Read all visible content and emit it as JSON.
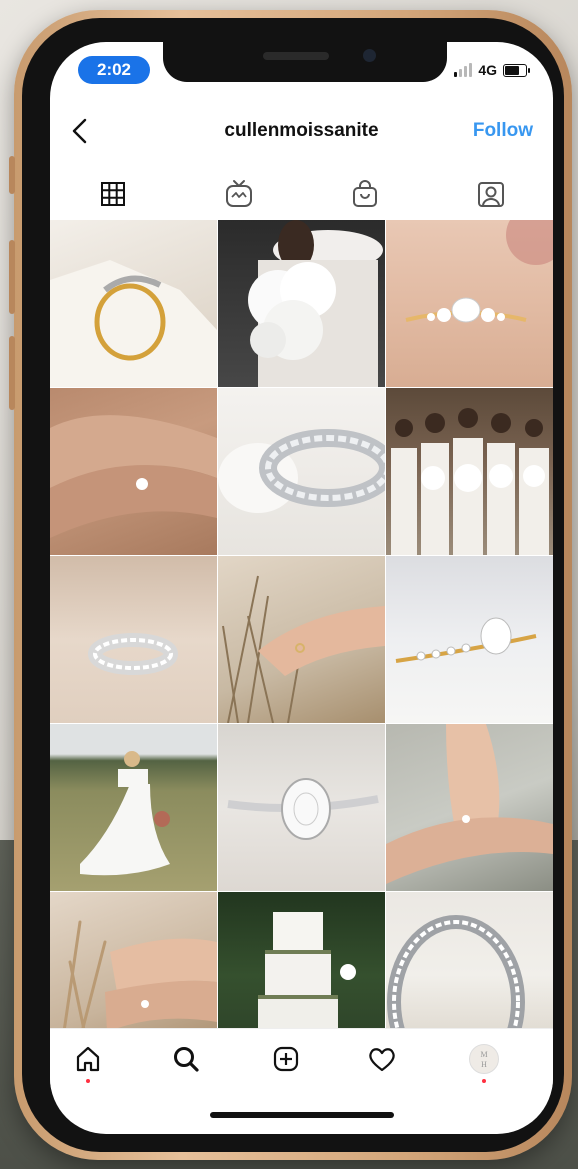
{
  "status_bar": {
    "time": "2:02",
    "network": "4G"
  },
  "header": {
    "username": "cullenmoissanite",
    "follow_label": "Follow",
    "back_icon": "chevron-left-icon"
  },
  "tabs": [
    {
      "icon": "grid-icon",
      "active": true
    },
    {
      "icon": "igtv-icon",
      "active": false
    },
    {
      "icon": "shopping-bag-icon",
      "active": false
    },
    {
      "icon": "tagged-user-icon",
      "active": false
    }
  ],
  "posts": [
    {
      "subject": "gold solitaire ring on white stone"
    },
    {
      "subject": "bride holding white bouquet"
    },
    {
      "subject": "oval cluster ring on peach background"
    },
    {
      "subject": "hands with oval engagement ring"
    },
    {
      "subject": "emerald cut eternity band"
    },
    {
      "subject": "bridesmaids in white dresses"
    },
    {
      "subject": "eternity band on sand"
    },
    {
      "subject": "hand in dried grasses"
    },
    {
      "subject": "oval ring with marquise side stones"
    },
    {
      "subject": "bride in field"
    },
    {
      "subject": "oval solitaire with pave band"
    },
    {
      "subject": "hands with ring on wrist"
    },
    {
      "subject": "hands among pampas grass"
    },
    {
      "subject": "white wedding cake"
    },
    {
      "subject": "close up eternity band"
    }
  ],
  "bottom_nav": [
    {
      "icon": "home-icon",
      "notification": true
    },
    {
      "icon": "search-icon",
      "notification": false
    },
    {
      "icon": "new-post-icon",
      "notification": false
    },
    {
      "icon": "heart-icon",
      "notification": false
    },
    {
      "icon": "profile-avatar",
      "notification": true
    }
  ],
  "colors": {
    "accent": "#3897f0",
    "time_pill": "#1a73e8",
    "notification_dot": "#ff3040",
    "phone_frame": "#d3a67a"
  }
}
